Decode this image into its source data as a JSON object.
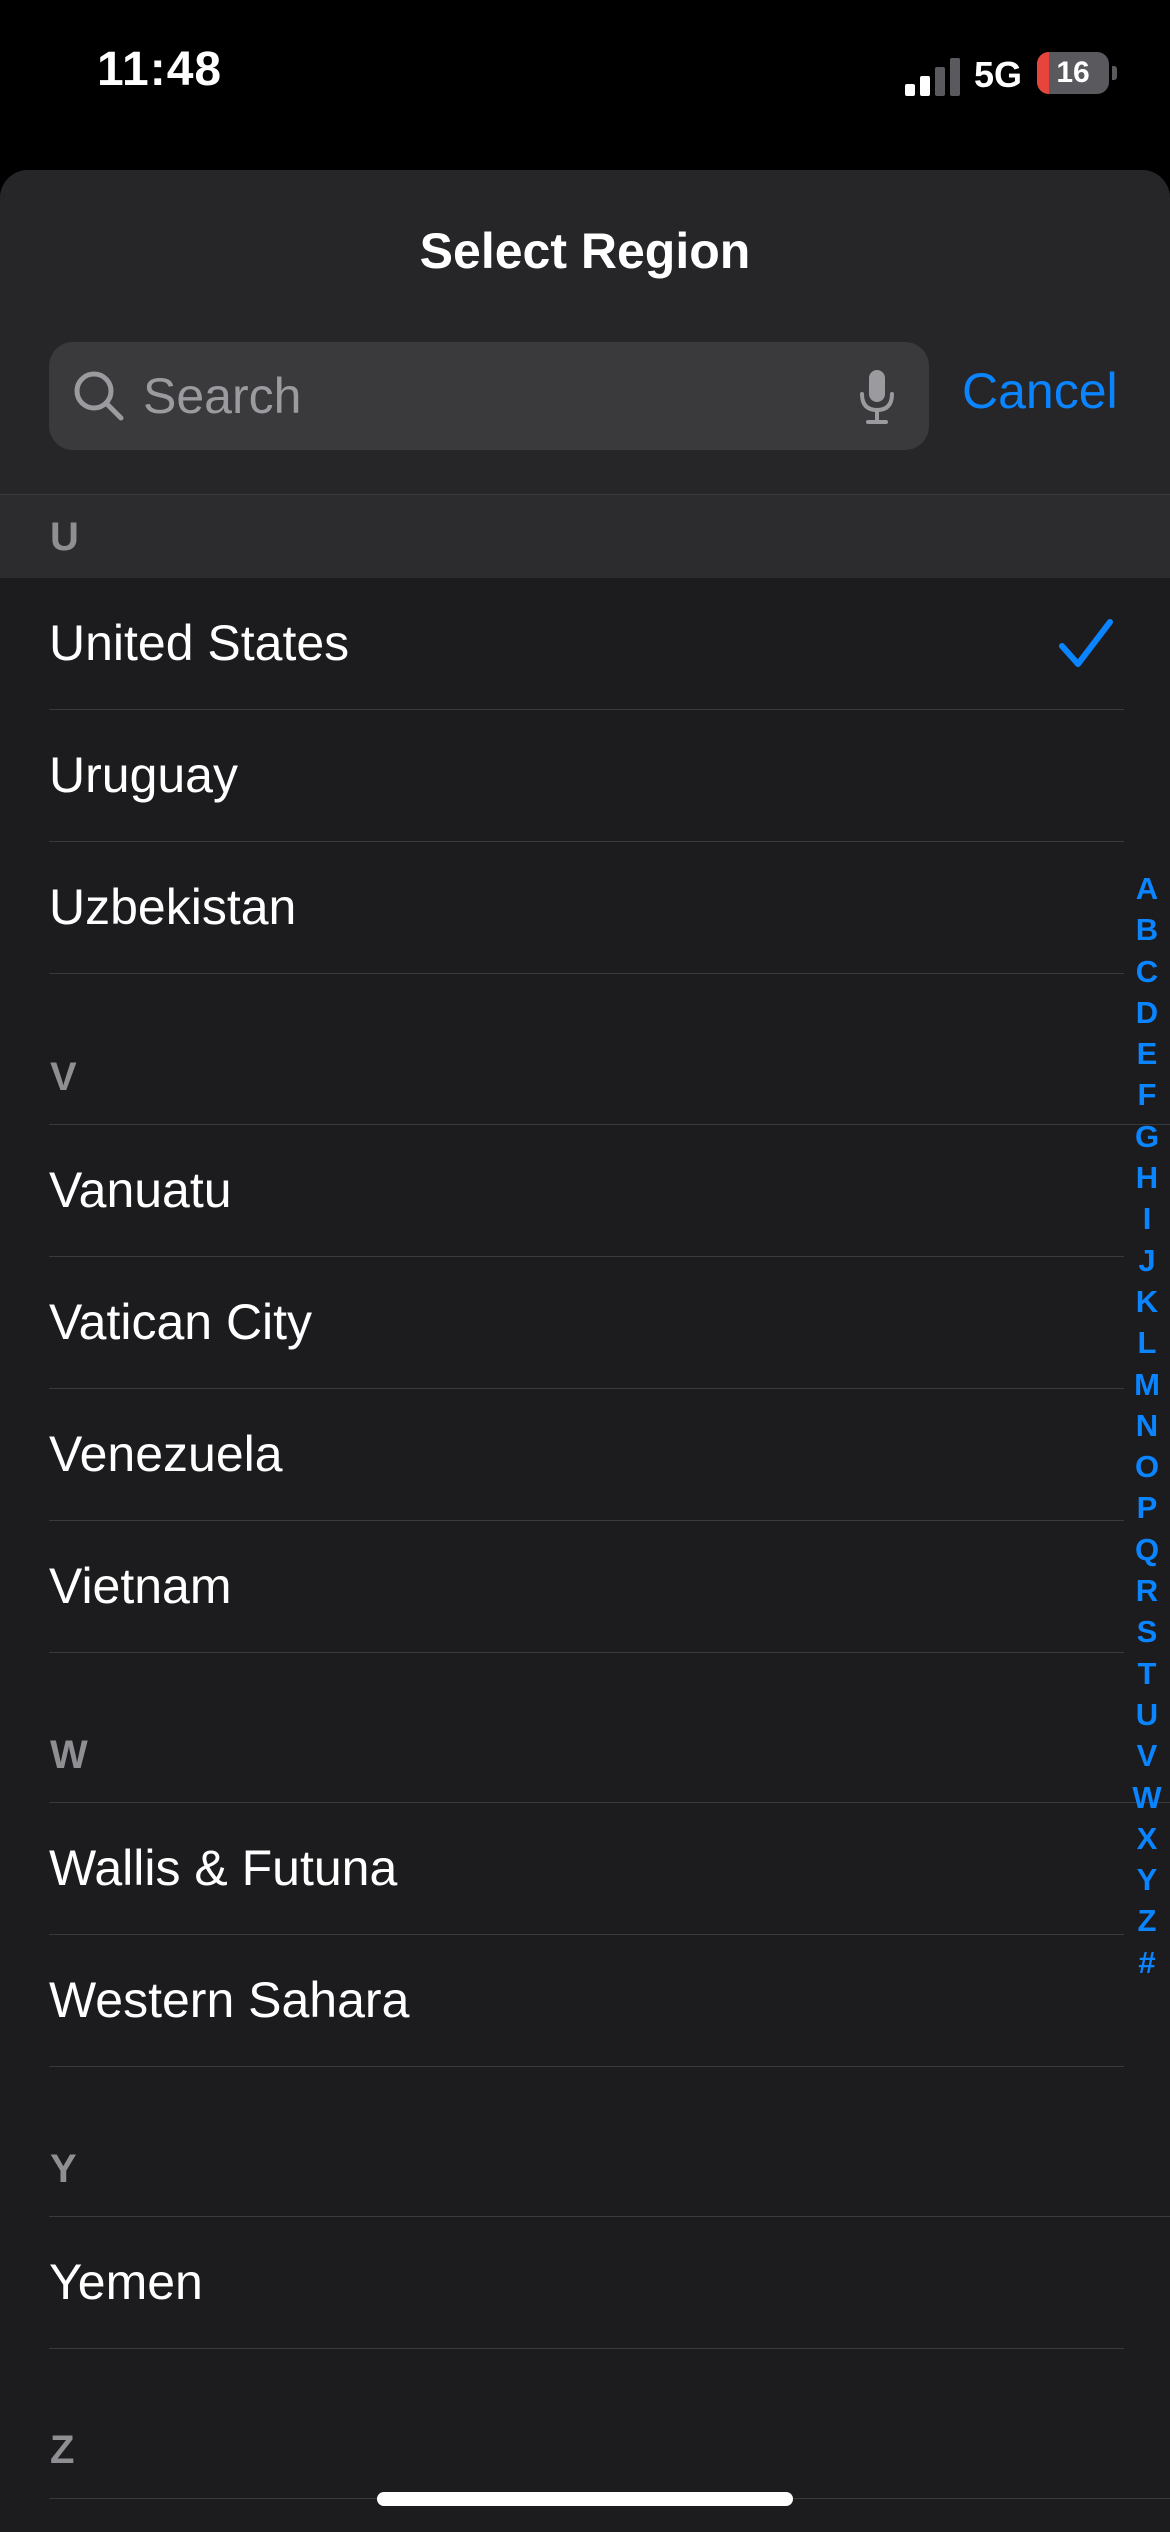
{
  "status_bar": {
    "time": "11:48",
    "network": "5G",
    "battery_level": "16",
    "battery_fraction": 0.16,
    "battery_color": "#e5453d"
  },
  "sheet": {
    "title": "Select Region",
    "search_placeholder": "Search",
    "cancel_label": "Cancel"
  },
  "sections": [
    {
      "letter": "U",
      "items": [
        {
          "label": "United States",
          "selected": true
        },
        {
          "label": "Uruguay",
          "selected": false
        },
        {
          "label": "Uzbekistan",
          "selected": false
        }
      ]
    },
    {
      "letter": "V",
      "items": [
        {
          "label": "Vanuatu",
          "selected": false
        },
        {
          "label": "Vatican City",
          "selected": false
        },
        {
          "label": "Venezuela",
          "selected": false
        },
        {
          "label": "Vietnam",
          "selected": false
        }
      ]
    },
    {
      "letter": "W",
      "items": [
        {
          "label": "Wallis & Futuna",
          "selected": false
        },
        {
          "label": "Western Sahara",
          "selected": false
        }
      ]
    },
    {
      "letter": "Y",
      "items": [
        {
          "label": "Yemen",
          "selected": false
        }
      ]
    },
    {
      "letter": "Z",
      "items": []
    }
  ],
  "index_letters": [
    "A",
    "B",
    "C",
    "D",
    "E",
    "F",
    "G",
    "H",
    "I",
    "J",
    "K",
    "L",
    "M",
    "N",
    "O",
    "P",
    "Q",
    "R",
    "S",
    "T",
    "U",
    "V",
    "W",
    "X",
    "Y",
    "Z",
    "#"
  ],
  "colors": {
    "accent": "#0a84ff",
    "background": "#1c1c1e",
    "header_background": "#262629"
  }
}
